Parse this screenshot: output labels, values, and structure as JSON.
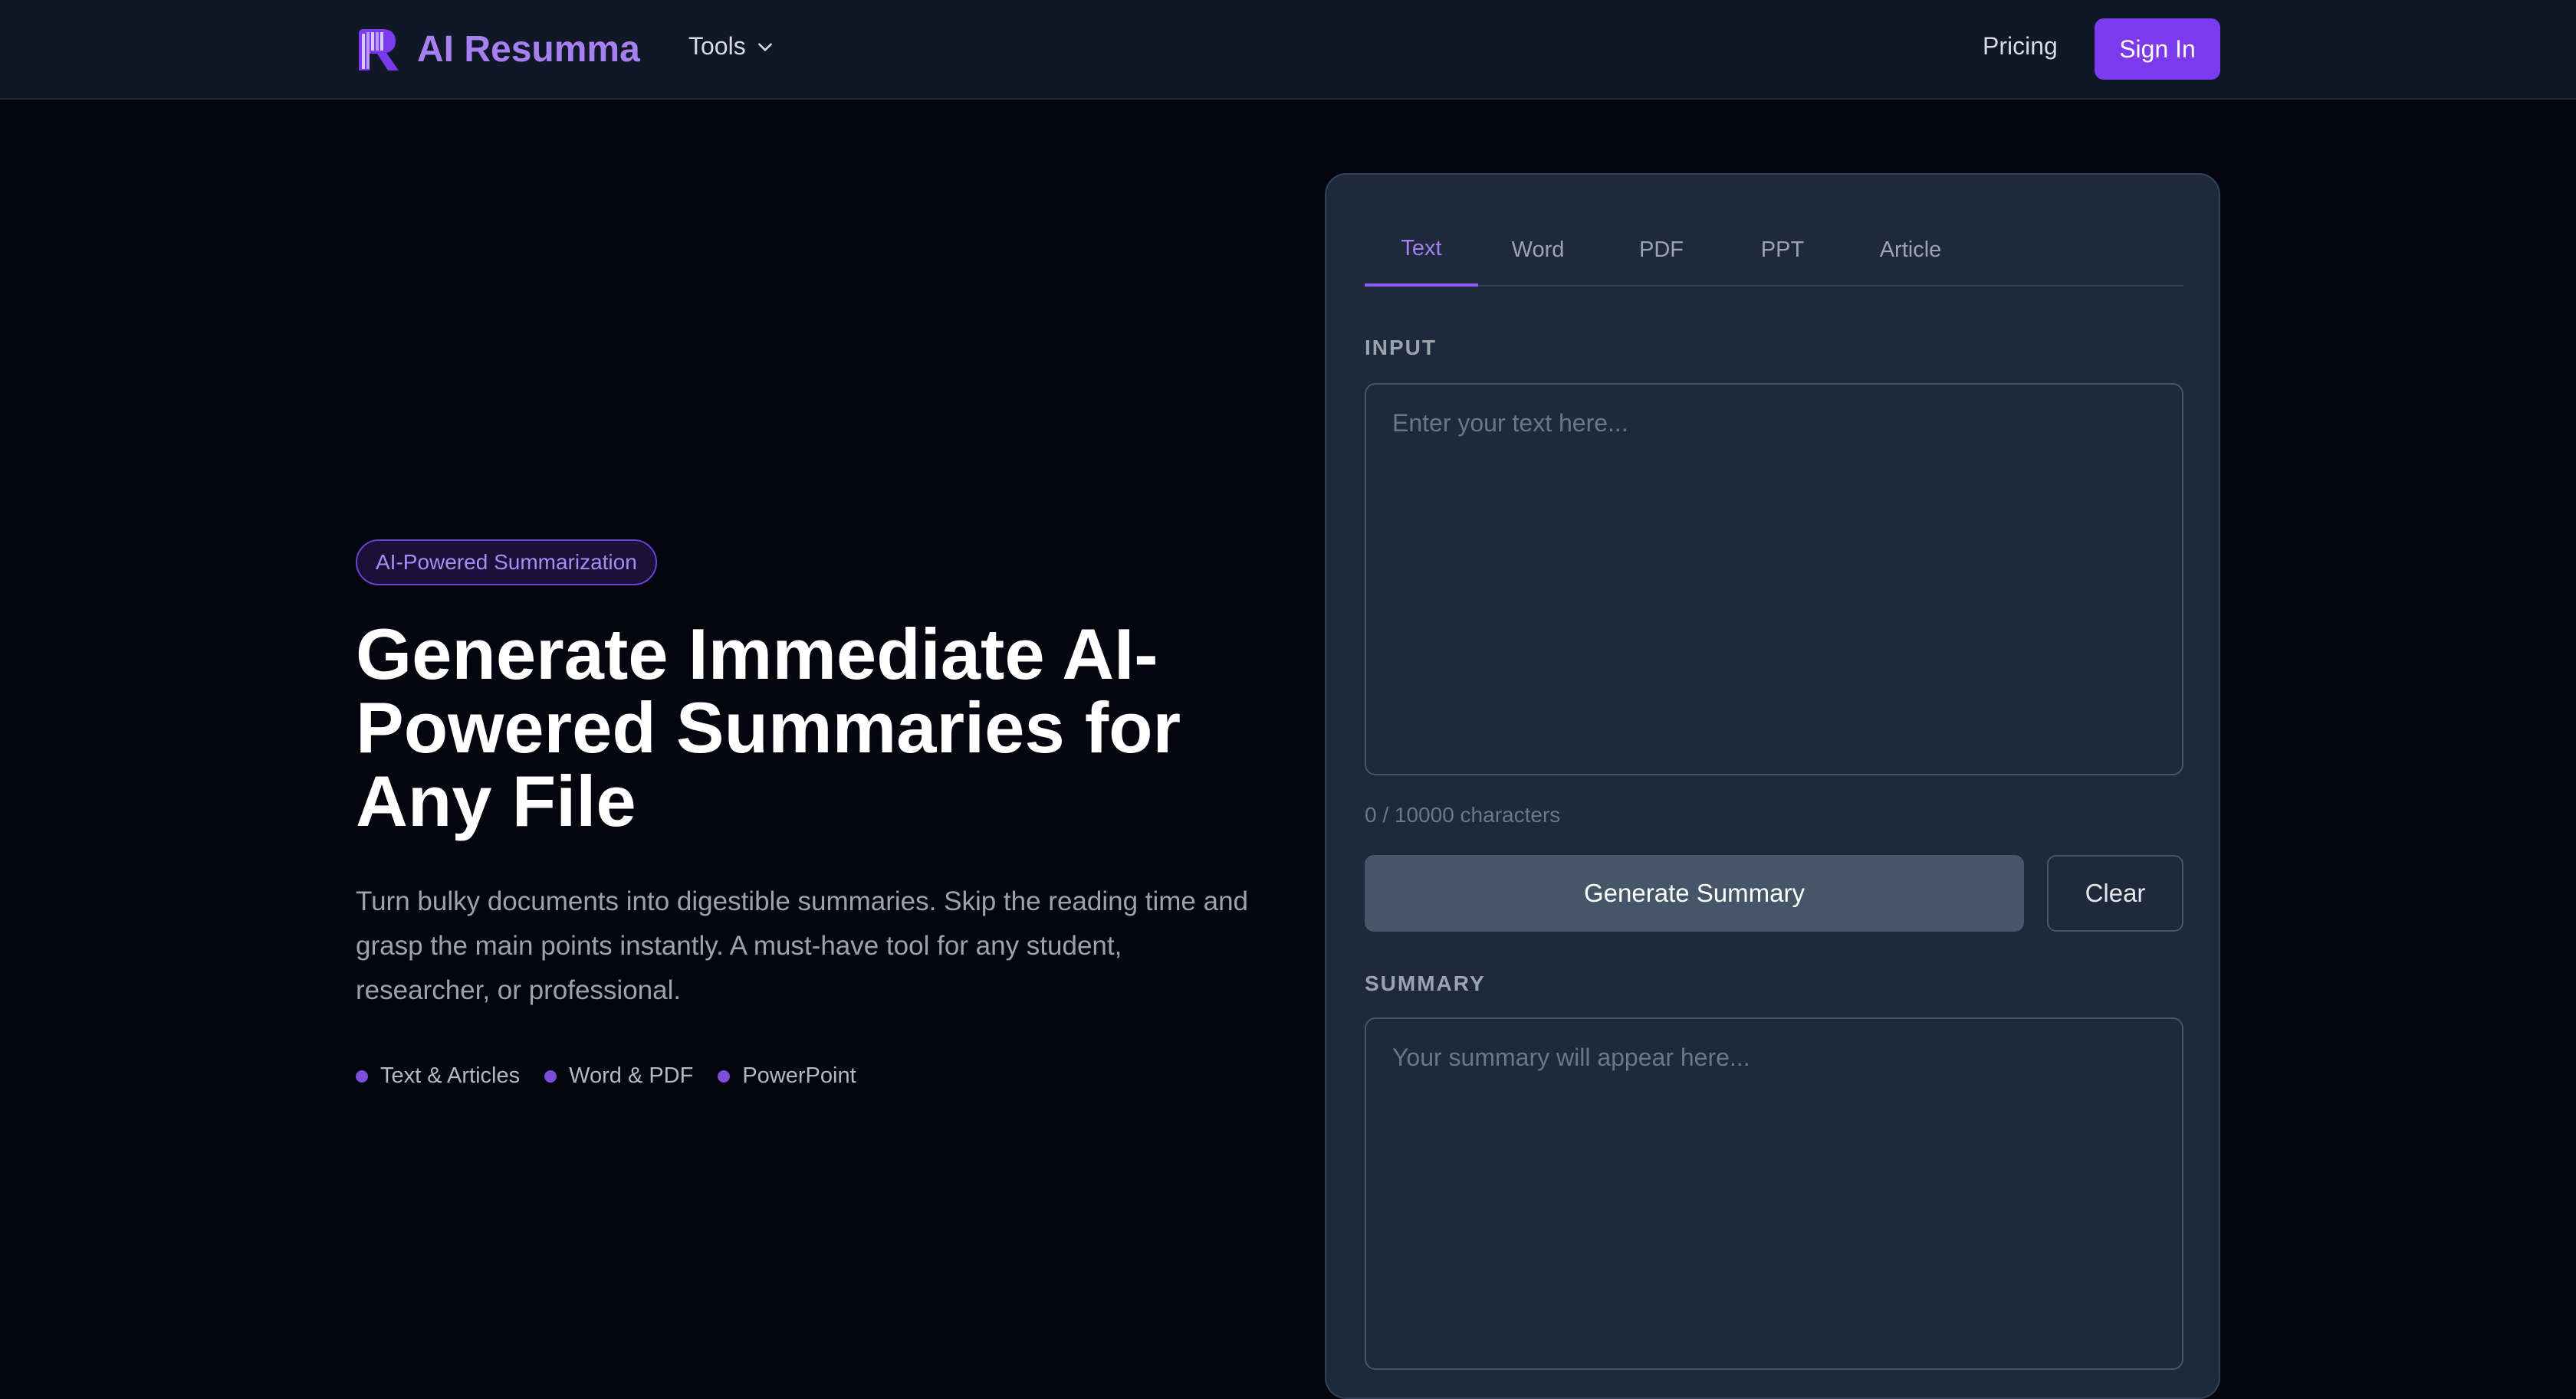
{
  "header": {
    "brand_name": "AI Resumma",
    "logo_icon": "resumma-r-logo-icon",
    "tools_label": "Tools",
    "pricing_label": "Pricing",
    "signin_label": "Sign In"
  },
  "hero": {
    "badge": "AI-Powered Summarization",
    "title_line1": "Generate Immediate AI-",
    "title_line2": "Powered Summaries for",
    "title_line3": "Any File",
    "description": "Turn bulky documents into digestible summaries. Skip the reading time and grasp the main points instantly. A must-have tool for any student, researcher, or professional.",
    "features": [
      "Text & Articles",
      "Word & PDF",
      "PowerPoint"
    ]
  },
  "panel": {
    "tabs": [
      {
        "label": "Text",
        "active": true
      },
      {
        "label": "Word",
        "active": false
      },
      {
        "label": "PDF",
        "active": false
      },
      {
        "label": "PPT",
        "active": false
      },
      {
        "label": "Article",
        "active": false
      }
    ],
    "input_label": "INPUT",
    "input_placeholder": "Enter your text here...",
    "input_value": "",
    "char_count": "0 / 10000 characters",
    "generate_label": "Generate Summary",
    "clear_label": "Clear",
    "summary_label": "SUMMARY",
    "summary_placeholder": "Your summary will appear here..."
  },
  "colors": {
    "accent": "#7c3aed",
    "brand_text": "#a67ff0",
    "background": "#04050f",
    "panel": "#1e293b"
  }
}
